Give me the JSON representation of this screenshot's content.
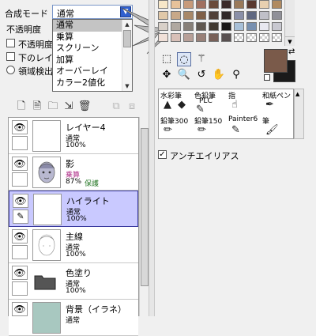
{
  "blend": {
    "label": "合成モード",
    "value": "通常",
    "options": [
      "通常",
      "乗算",
      "スクリーン",
      "加算",
      "オーバーレイ",
      "カラー2値化"
    ]
  },
  "opacity_label": "不透明度",
  "check_protect": "不透明度",
  "check_below": "下のレイヤ",
  "radio_region": "領域検出",
  "toolbar": {
    "icons": [
      "new-layer-icon",
      "new-page-icon",
      "folder-icon",
      "transfer-icon",
      "erase-icon",
      "delete-icon",
      "merge-down-icon",
      "merge-visible-icon"
    ]
  },
  "layers": [
    {
      "name": "レイヤー4",
      "blend": "通常",
      "opacity": "100%",
      "extra": "",
      "visible": true,
      "selected": false,
      "thumb": "blank"
    },
    {
      "name": "影",
      "blend": "乗算",
      "opacity": "87%",
      "extra": "保護",
      "visible": true,
      "selected": false,
      "thumb": "face"
    },
    {
      "name": "ハイライト",
      "blend": "通常",
      "opacity": "100%",
      "extra": "",
      "visible": true,
      "selected": true,
      "thumb": "blank"
    },
    {
      "name": "主線",
      "blend": "通常",
      "opacity": "100%",
      "extra": "",
      "visible": true,
      "selected": false,
      "thumb": "sketch"
    },
    {
      "name": "色塗り",
      "blend": "通常",
      "opacity": "100%",
      "extra": "",
      "visible": true,
      "selected": false,
      "thumb": "folder"
    },
    {
      "name": "背景（イラネ）",
      "blend": "通常",
      "opacity": "",
      "extra": "",
      "visible": true,
      "selected": false,
      "thumb": "teal"
    }
  ],
  "palette": {
    "colors": [
      [
        "#f7e7c8",
        "#e7c29a",
        "#c79a7a",
        "#a07060",
        "#6a4a3a",
        "#3a2a28",
        "#9a7a5a",
        "#5a3a30",
        "#e8d0b0",
        "#b08a60"
      ],
      [
        "#e0c8a8",
        "#c8a888",
        "#a88868",
        "#806048",
        "#504038",
        "#302828",
        "#8a90a8",
        "#606880",
        "#c0c0c8",
        "#909098"
      ],
      [
        "#d8d0c8",
        "#b0a8a0",
        "#888078",
        "#605850",
        "#403830",
        "#1a1818",
        "#a8c0d8",
        "#7890b0",
        "#e8e8f0",
        "#c8c8d0"
      ],
      [
        "#f0e0d8",
        "#d8c0b8",
        "#b8a098",
        "#988078",
        "#786058",
        "#585050",
        "checker",
        "checker",
        "checker",
        "checker"
      ]
    ]
  },
  "color": {
    "primary": "#7a5a4a",
    "secondary": "#1a1a1a"
  },
  "tools": {
    "row1": [
      "rect-select-icon",
      "lasso-select-icon",
      "magic-wand-icon"
    ],
    "row2": [
      "move-icon",
      "zoom-icon",
      "rotate-icon",
      "hand-icon",
      "eyedropper-icon"
    ]
  },
  "brushes": [
    {
      "name": "水彩筆",
      "icons": [
        "▲",
        "💧"
      ]
    },
    {
      "name": "色鉛筆",
      "sub": "PLC",
      "icons": [
        "✎"
      ]
    },
    {
      "name": "指",
      "icons": [
        "☝"
      ]
    },
    {
      "name": "和紙ペン",
      "icons": [
        "✒"
      ]
    },
    {
      "name": "鉛筆300",
      "icons": [
        "✏"
      ]
    },
    {
      "name": "鉛筆150",
      "icons": [
        "✏"
      ]
    },
    {
      "name": "Painter6",
      "icons": [
        "✎"
      ]
    },
    {
      "name": "筆",
      "icons": [
        "🖌"
      ]
    }
  ],
  "antialias_label": "アンチエイリアス",
  "antialias_checked": true
}
